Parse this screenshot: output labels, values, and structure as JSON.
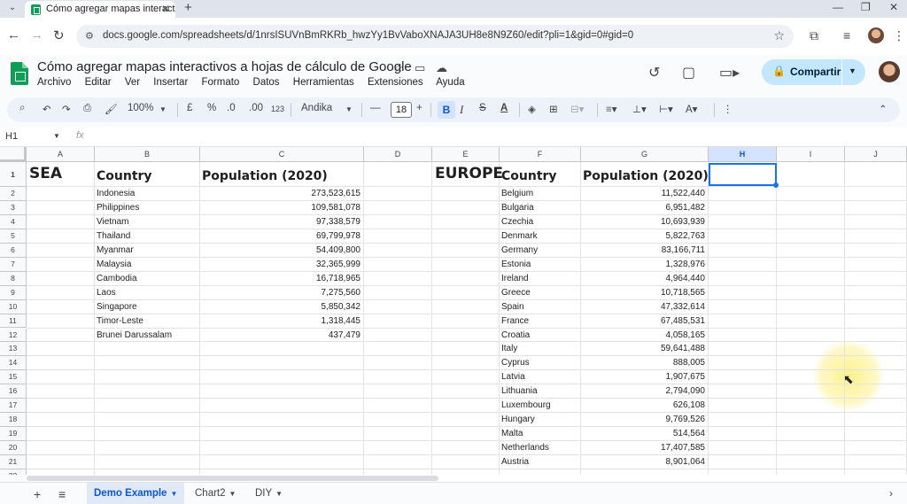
{
  "browser": {
    "tab_title": "Cómo agregar mapas interactiv",
    "url": "docs.google.com/spreadsheets/d/1nrsISUVnBmRKRb_hwzYy1BvVaboXNAJA3UH8e8N9Z60/edit?pli=1&gid=0#gid=0"
  },
  "doc": {
    "title": "Cómo agregar mapas interactivos a hojas de cálculo de Google",
    "menus": [
      "Archivo",
      "Editar",
      "Ver",
      "Insertar",
      "Formato",
      "Datos",
      "Herramientas",
      "Extensiones",
      "Ayuda"
    ],
    "share_label": "Compartir"
  },
  "toolbar": {
    "zoom": "100%",
    "currency": "£",
    "percent": "%",
    "dec_decrease": ".0",
    "dec_increase": ".00",
    "number_format": "123",
    "font": "Andika",
    "font_size": "18",
    "bold": "B",
    "italic": "I",
    "strike": "S",
    "text_color": "A"
  },
  "formula_bar": {
    "name_box": "H1",
    "fx": "fx",
    "value": ""
  },
  "columns": [
    "A",
    "B",
    "C",
    "D",
    "E",
    "F",
    "G",
    "H",
    "I",
    "J"
  ],
  "rows": [
    "1",
    "2",
    "3",
    "4",
    "5",
    "6",
    "7",
    "8",
    "9",
    "10",
    "11",
    "12",
    "13",
    "14",
    "15",
    "16",
    "17",
    "18",
    "19",
    "20",
    "21",
    "22"
  ],
  "sea": {
    "heading": "SEA",
    "country_header": "Country",
    "pop_header": "Population (2020)",
    "rows": [
      {
        "country": "Indonesia",
        "pop": "273,523,615"
      },
      {
        "country": "Philippines",
        "pop": "109,581,078"
      },
      {
        "country": "Vietnam",
        "pop": "97,338,579"
      },
      {
        "country": "Thailand",
        "pop": "69,799,978"
      },
      {
        "country": "Myanmar",
        "pop": "54,409,800"
      },
      {
        "country": "Malaysia",
        "pop": "32,365,999"
      },
      {
        "country": "Cambodia",
        "pop": "16,718,965"
      },
      {
        "country": "Laos",
        "pop": "7,275,560"
      },
      {
        "country": "Singapore",
        "pop": "5,850,342"
      },
      {
        "country": "Timor-Leste",
        "pop": "1,318,445"
      },
      {
        "country": "Brunei Darussalam",
        "pop": "437,479"
      }
    ]
  },
  "europe": {
    "heading": "EUROPE",
    "country_header": "Country",
    "pop_header": "Population (2020)",
    "rows": [
      {
        "country": "Belgium",
        "pop": "11,522,440"
      },
      {
        "country": "Bulgaria",
        "pop": "6,951,482"
      },
      {
        "country": "Czechia",
        "pop": "10,693,939"
      },
      {
        "country": "Denmark",
        "pop": "5,822,763"
      },
      {
        "country": "Germany",
        "pop": "83,166,711"
      },
      {
        "country": "Estonia",
        "pop": "1,328,976"
      },
      {
        "country": "Ireland",
        "pop": "4,964,440"
      },
      {
        "country": "Greece",
        "pop": "10,718,565"
      },
      {
        "country": "Spain",
        "pop": "47,332,614"
      },
      {
        "country": "France",
        "pop": "67,485,531"
      },
      {
        "country": "Croatia",
        "pop": "4,058,165"
      },
      {
        "country": "Italy",
        "pop": "59,641,488"
      },
      {
        "country": "Cyprus",
        "pop": "888,005"
      },
      {
        "country": "Latvia",
        "pop": "1,907,675"
      },
      {
        "country": "Lithuania",
        "pop": "2,794,090"
      },
      {
        "country": "Luxembourg",
        "pop": "626,108"
      },
      {
        "country": "Hungary",
        "pop": "9,769,526"
      },
      {
        "country": "Malta",
        "pop": "514,564"
      },
      {
        "country": "Netherlands",
        "pop": "17,407,585"
      },
      {
        "country": "Austria",
        "pop": "8,901,064"
      }
    ]
  },
  "sheet_tabs": [
    "Demo Example",
    "Chart2",
    "DIY"
  ],
  "colors": {
    "accent": "#1a73e8",
    "share_bg": "#c2e7ff",
    "sheets_green": "#0f9d58"
  }
}
